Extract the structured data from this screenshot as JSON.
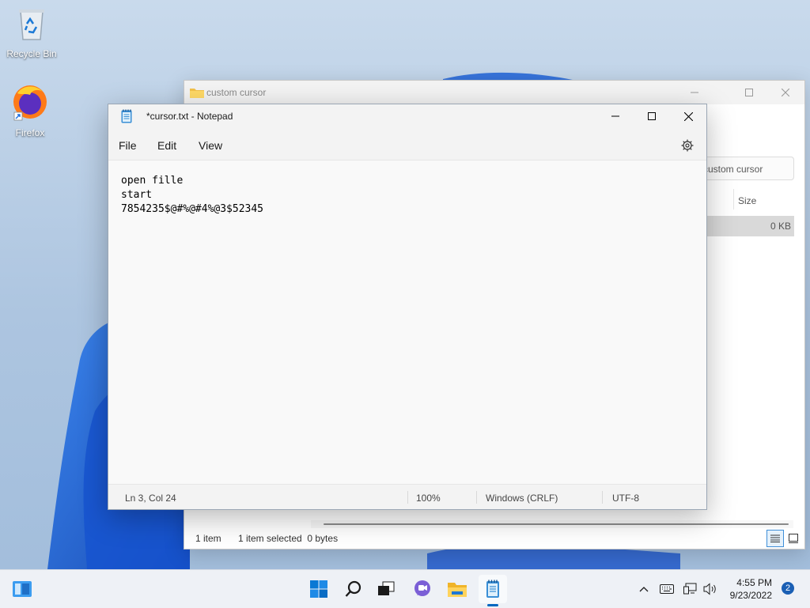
{
  "desktop": {
    "icons": [
      {
        "label": "Recycle Bin"
      },
      {
        "label": "Firefox"
      }
    ]
  },
  "explorer": {
    "title": "custom cursor",
    "search_placeholder": "custom cursor",
    "column_size": "Size",
    "row_size": "0 KB",
    "status": {
      "item_count": "1 item",
      "selection": "1 item selected  0 bytes"
    }
  },
  "notepad": {
    "title": "*cursor.txt - Notepad",
    "menu": {
      "file": "File",
      "edit": "Edit",
      "view": "View"
    },
    "lines": [
      "open fille",
      "start",
      "7854235$@#%@#4%@3$52345"
    ],
    "status": {
      "position": "Ln 3, Col 24",
      "zoom": "100%",
      "line_ending": "Windows (CRLF)",
      "encoding": "UTF-8"
    }
  },
  "taskbar": {
    "clock": {
      "time": "4:55 PM",
      "date": "9/23/2022"
    },
    "notification_count": "2"
  },
  "colors": {
    "accent": "#0067c0",
    "desktop": "#b9cfe6",
    "bloom": "#1a63d6"
  }
}
